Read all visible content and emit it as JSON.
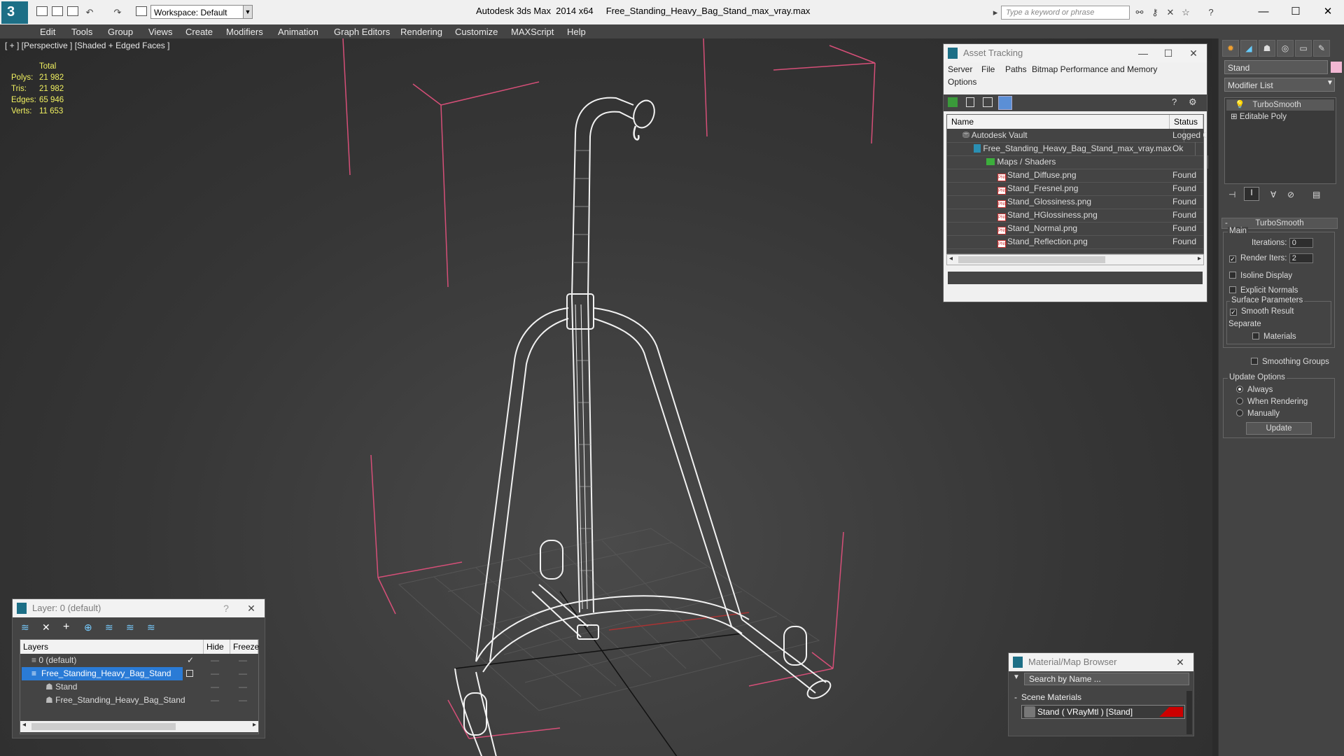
{
  "titlebar": {
    "workspace": "Workspace: Default",
    "title": "Autodesk 3ds Max  2014 x64     Free_Standing_Heavy_Bag_Stand_max_vray.max",
    "search_placeholder": "Type a keyword or phrase"
  },
  "menu": [
    "Edit",
    "Tools",
    "Group",
    "Views",
    "Create",
    "Modifiers",
    "Animation",
    "Graph Editors",
    "Rendering",
    "Customize",
    "MAXScript",
    "Help"
  ],
  "viewport": {
    "label": "[ + ] [Perspective ] [Shaded + Edged Faces ]",
    "stats": {
      "header": "Total",
      "rows": [
        {
          "k": "Polys:",
          "v": "21 982"
        },
        {
          "k": "Tris:",
          "v": "21 982"
        },
        {
          "k": "Edges:",
          "v": "65 946"
        },
        {
          "k": "Verts:",
          "v": "11 653"
        }
      ]
    }
  },
  "asset_tracking": {
    "title": "Asset Tracking",
    "menu_row1": [
      "Server",
      "File",
      "Paths",
      "Bitmap Performance and Memory"
    ],
    "menu_row2": [
      "Options"
    ],
    "columns": [
      "Name",
      "Status"
    ],
    "rows": [
      {
        "name": "Autodesk Vault",
        "status": "Logged O"
      },
      {
        "name": "Free_Standing_Heavy_Bag_Stand_max_vray.max",
        "status": "Ok"
      },
      {
        "name": "Maps / Shaders",
        "status": ""
      },
      {
        "name": "Stand_Diffuse.png",
        "status": "Found"
      },
      {
        "name": "Stand_Fresnel.png",
        "status": "Found"
      },
      {
        "name": "Stand_Glossiness.png",
        "status": "Found"
      },
      {
        "name": "Stand_HGlossiness.png",
        "status": "Found"
      },
      {
        "name": "Stand_Normal.png",
        "status": "Found"
      },
      {
        "name": "Stand_Reflection.png",
        "status": "Found"
      }
    ]
  },
  "command_panel": {
    "object_name": "Stand",
    "modifier_list": "Modifier List",
    "stack": [
      "TurboSmooth",
      "Editable Poly"
    ],
    "rollout_title": "TurboSmooth",
    "main_label": "Main",
    "iterations_label": "Iterations:",
    "iterations_value": "0",
    "render_iters_label": "Render Iters:",
    "render_iters_value": "2",
    "isoline_label": "Isoline Display",
    "explicit_label": "Explicit Normals",
    "surface_label": "Surface Parameters",
    "smooth_label": "Smooth Result",
    "separate_label": "Separate",
    "materials_label": "Materials",
    "smoothing_groups_label": "Smoothing Groups",
    "update_options_label": "Update Options",
    "always_label": "Always",
    "when_rendering_label": "When Rendering",
    "manually_label": "Manually",
    "update_button": "Update"
  },
  "layer_panel": {
    "title": "Layer: 0 (default)",
    "columns": [
      "Layers",
      "Hide",
      "Freeze"
    ],
    "rows": [
      {
        "name": "0 (default)"
      },
      {
        "name": "Free_Standing_Heavy_Bag_Stand"
      },
      {
        "name": "Stand"
      },
      {
        "name": "Free_Standing_Heavy_Bag_Stand"
      }
    ]
  },
  "material_browser": {
    "title": "Material/Map Browser",
    "search_placeholder": "Search by Name ...",
    "section": "Scene Materials",
    "item": "Stand  ( VRayMtl ) [Stand]"
  },
  "colors": {
    "accent": "#1d6f86",
    "selection": "#2a7bd6",
    "stats_text": "#f0f060",
    "bounding_box": "#d64f78"
  }
}
